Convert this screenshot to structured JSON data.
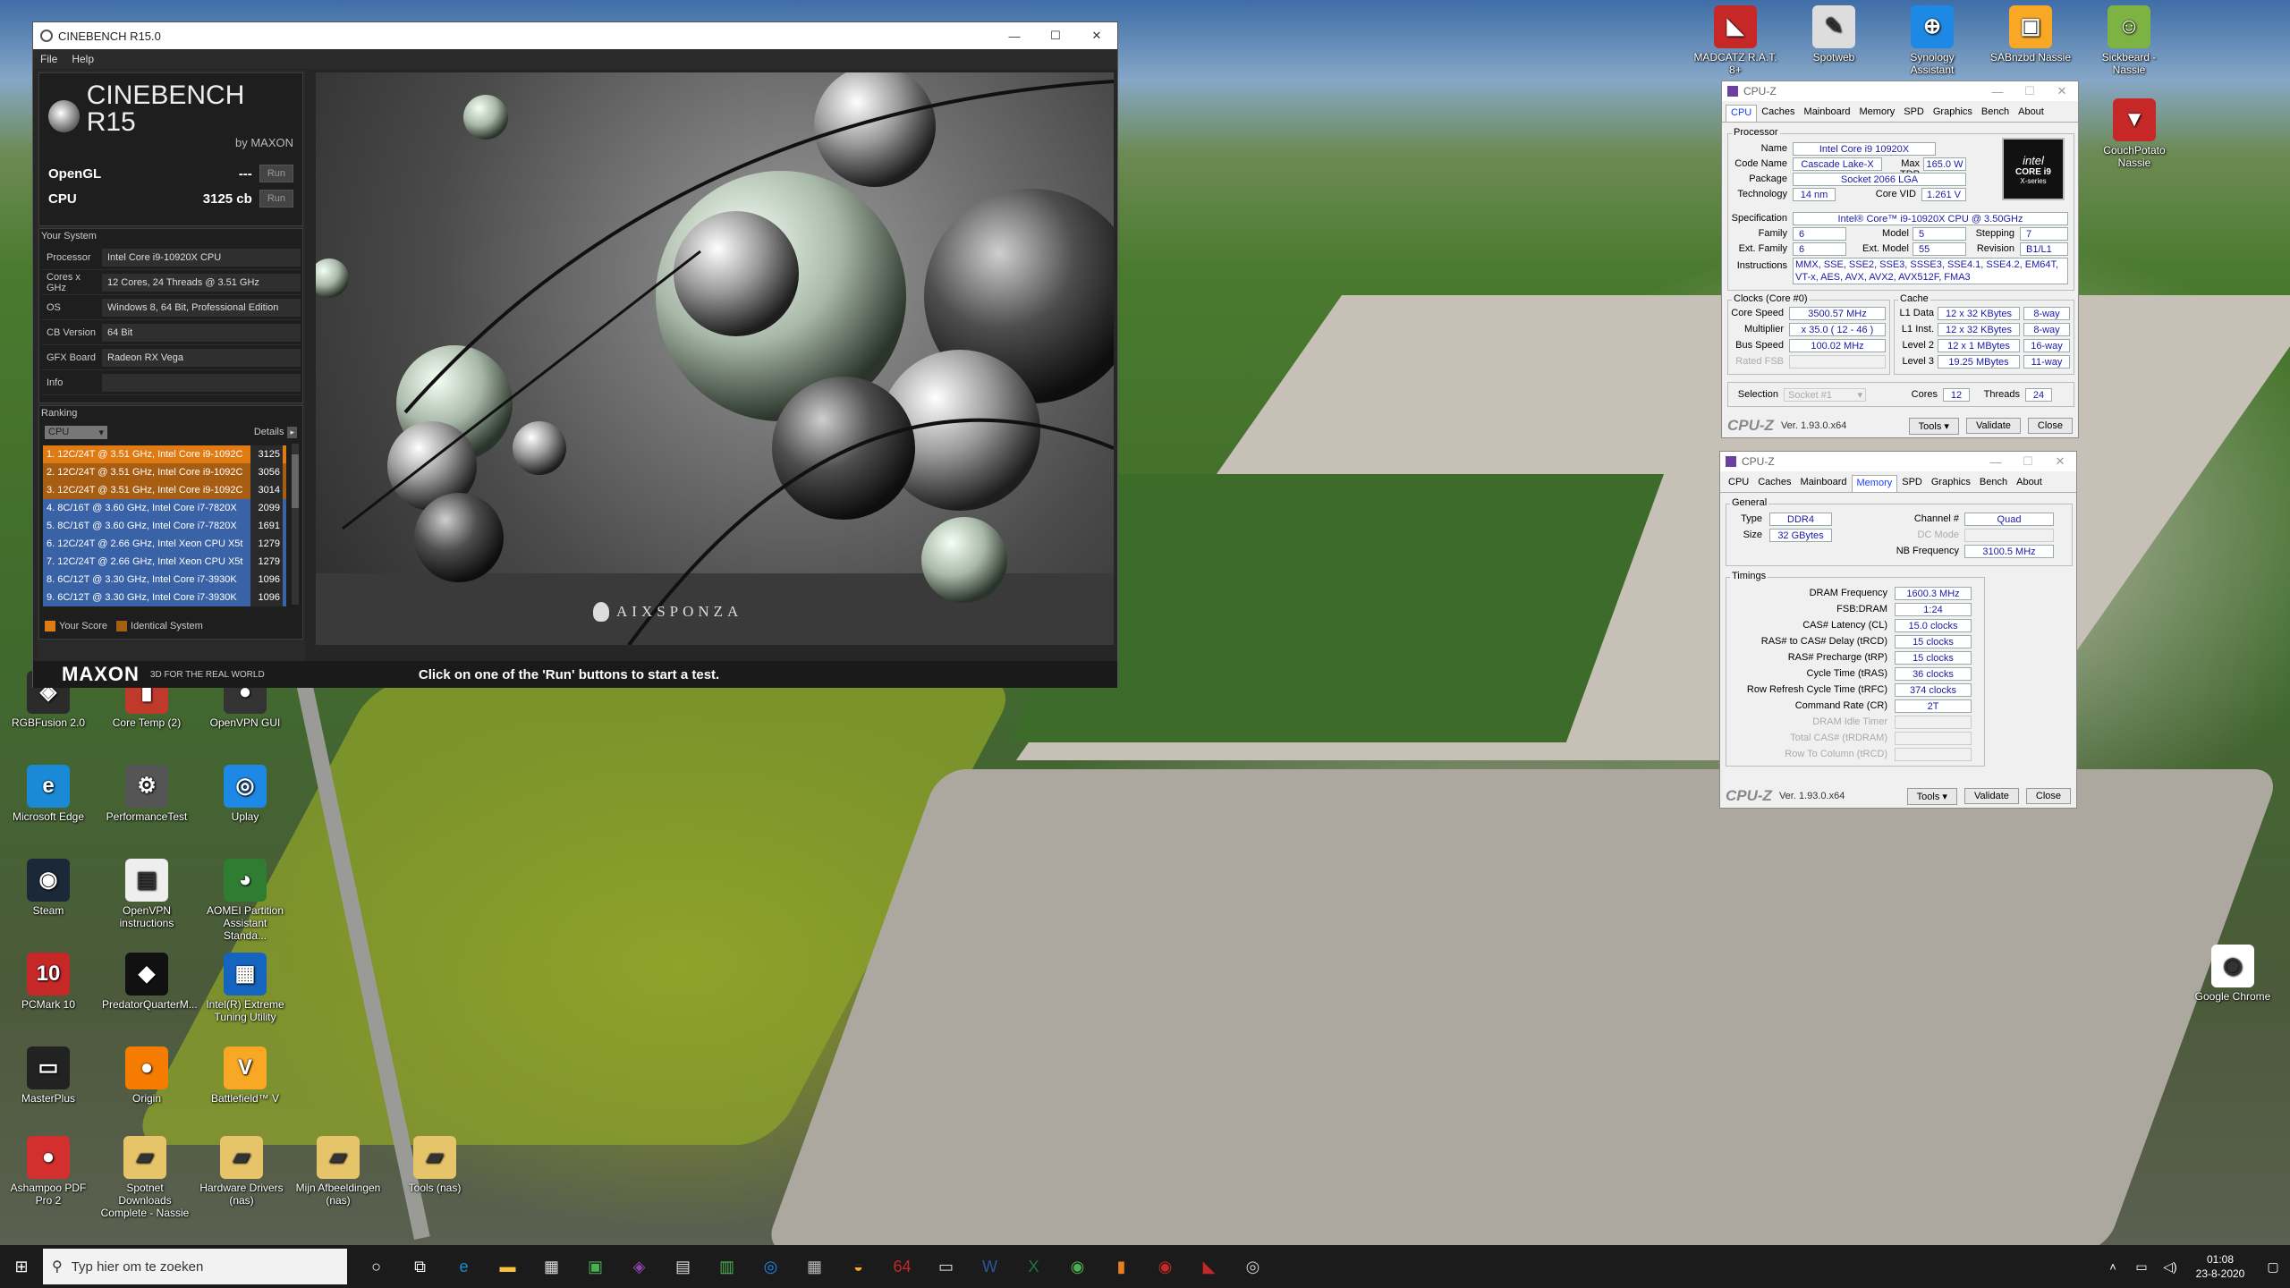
{
  "cinebench": {
    "title": "CINEBENCH R15.0",
    "menu": [
      "File",
      "Help"
    ],
    "logo_title": "CINEBENCH R15",
    "logo_by": "by MAXON",
    "opengl_label": "OpenGL",
    "opengl_value": "---",
    "cpu_label": "CPU",
    "cpu_value": "3125 cb",
    "run_label": "Run",
    "system_header": "Your System",
    "system": [
      {
        "k": "Processor",
        "v": "Intel Core i9-10920X CPU"
      },
      {
        "k": "Cores x GHz",
        "v": "12 Cores, 24 Threads @ 3.51 GHz"
      },
      {
        "k": "OS",
        "v": "Windows 8, 64 Bit, Professional Edition"
      },
      {
        "k": "CB Version",
        "v": "64 Bit"
      },
      {
        "k": "GFX Board",
        "v": "Radeon RX Vega"
      },
      {
        "k": "Info",
        "v": ""
      }
    ],
    "ranking_header": "Ranking",
    "ranking_select": "CPU",
    "details_label": "Details",
    "ranking": [
      {
        "name": "1. 12C/24T @ 3.51 GHz, Intel Core i9-1092C",
        "score": "3125",
        "kind": "mine"
      },
      {
        "name": "2. 12C/24T @ 3.51 GHz, Intel Core i9-1092C",
        "score": "3056",
        "kind": "identical"
      },
      {
        "name": "3. 12C/24T @ 3.51 GHz, Intel Core i9-1092C",
        "score": "3014",
        "kind": "identical"
      },
      {
        "name": "4. 8C/16T @ 3.60 GHz, Intel Core i7-7820X",
        "score": "2099",
        "kind": "other"
      },
      {
        "name": "5. 8C/16T @ 3.60 GHz, Intel Core i7-7820X",
        "score": "1691",
        "kind": "other"
      },
      {
        "name": "6. 12C/24T @ 2.66 GHz, Intel Xeon CPU X5t",
        "score": "1279",
        "kind": "other"
      },
      {
        "name": "7. 12C/24T @ 2.66 GHz, Intel Xeon CPU X5t",
        "score": "1279",
        "kind": "other"
      },
      {
        "name": "8. 6C/12T @ 3.30 GHz,  Intel Core i7-3930K",
        "score": "1096",
        "kind": "other"
      },
      {
        "name": "9. 6C/12T @ 3.30 GHz,  Intel Core i7-3930K",
        "score": "1096",
        "kind": "other"
      }
    ],
    "legend_your": "Your Score",
    "legend_identical": "Identical System",
    "footer_brand": "MAXON",
    "footer_tag": "3D FOR THE REAL WORLD",
    "status": "Click on one of the 'Run' buttons to start a test.",
    "render_brand": "AIXSPONZA"
  },
  "cpuz1": {
    "title": "CPU-Z",
    "tabs": [
      "CPU",
      "Caches",
      "Mainboard",
      "Memory",
      "SPD",
      "Graphics",
      "Bench",
      "About"
    ],
    "processor_label": "Processor",
    "name_l": "Name",
    "name_v": "Intel Core i9 10920X",
    "code_l": "Code Name",
    "code_v": "Cascade Lake-X",
    "tdp_l": "Max TDP",
    "tdp_v": "165.0 W",
    "pkg_l": "Package",
    "pkg_v": "Socket 2066 LGA",
    "tech_l": "Technology",
    "tech_v": "14 nm",
    "vid_l": "Core VID",
    "vid_v": "1.261 V",
    "spec_l": "Specification",
    "spec_v": "Intel® Core™ i9-10920X CPU @ 3.50GHz",
    "fam_l": "Family",
    "fam_v": "6",
    "model_l": "Model",
    "model_v": "5",
    "step_l": "Stepping",
    "step_v": "7",
    "extfam_l": "Ext. Family",
    "extfam_v": "6",
    "extmod_l": "Ext. Model",
    "extmod_v": "55",
    "rev_l": "Revision",
    "rev_v": "B1/L1",
    "instr_l": "Instructions",
    "instr_v": "MMX, SSE, SSE2, SSE3, SSSE3, SSE4.1, SSE4.2, EM64T, VT-x, AES, AVX, AVX2, AVX512F, FMA3",
    "badge_top": "intel",
    "badge_mid": "CORE i9",
    "badge_bot": "X-series",
    "clocks_label": "Clocks (Core #0)",
    "cs_l": "Core Speed",
    "cs_v": "3500.57 MHz",
    "mul_l": "Multiplier",
    "mul_v": "x 35.0 ( 12 - 46 )",
    "bus_l": "Bus Speed",
    "bus_v": "100.02 MHz",
    "fsb_l": "Rated FSB",
    "cache_label": "Cache",
    "l1d_l": "L1 Data",
    "l1d_v": "12 x 32 KBytes",
    "l1d_w": "8-way",
    "l1i_l": "L1 Inst.",
    "l1i_v": "12 x 32 KBytes",
    "l1i_w": "8-way",
    "l2_l": "Level 2",
    "l2_v": "12 x 1 MBytes",
    "l2_w": "16-way",
    "l3_l": "Level 3",
    "l3_v": "19.25 MBytes",
    "l3_w": "11-way",
    "sel_l": "Selection",
    "sel_v": "Socket #1",
    "cores_l": "Cores",
    "cores_v": "12",
    "threads_l": "Threads",
    "threads_v": "24",
    "brand": "CPU-Z",
    "version": "Ver. 1.93.0.x64",
    "tools": "Tools",
    "validate": "Validate",
    "close": "Close"
  },
  "cpuz2": {
    "title": "CPU-Z",
    "general_label": "General",
    "type_l": "Type",
    "type_v": "DDR4",
    "size_l": "Size",
    "size_v": "32 GBytes",
    "chan_l": "Channel #",
    "chan_v": "Quad",
    "dc_l": "DC Mode",
    "nb_l": "NB Frequency",
    "nb_v": "3100.5 MHz",
    "timings_label": "Timings",
    "timings": [
      {
        "l": "DRAM Frequency",
        "v": "1600.3 MHz",
        "dis": false
      },
      {
        "l": "FSB:DRAM",
        "v": "1:24",
        "dis": false
      },
      {
        "l": "CAS# Latency (CL)",
        "v": "15.0 clocks",
        "dis": false
      },
      {
        "l": "RAS# to CAS# Delay (tRCD)",
        "v": "15 clocks",
        "dis": false
      },
      {
        "l": "RAS# Precharge (tRP)",
        "v": "15 clocks",
        "dis": false
      },
      {
        "l": "Cycle Time (tRAS)",
        "v": "36 clocks",
        "dis": false
      },
      {
        "l": "Row Refresh Cycle Time (tRFC)",
        "v": "374 clocks",
        "dis": false
      },
      {
        "l": "Command Rate (CR)",
        "v": "2T",
        "dis": false
      },
      {
        "l": "DRAM Idle Timer",
        "v": "",
        "dis": true
      },
      {
        "l": "Total CAS# (tRDRAM)",
        "v": "",
        "dis": true
      },
      {
        "l": "Row To Column (tRCD)",
        "v": "",
        "dis": true
      }
    ]
  },
  "desktop_icons_left": [
    {
      "label": "RGBFusion 2.0",
      "color": "#2b2b2b",
      "glyph": "◈"
    },
    {
      "label": "Core Temp (2)",
      "color": "#c0392b",
      "glyph": "▮"
    },
    {
      "label": "OpenVPN GUI",
      "color": "#333",
      "glyph": "●"
    },
    {
      "label": "Microsoft Edge",
      "color": "#1b8ad6",
      "glyph": "e"
    },
    {
      "label": "PerformanceTest",
      "color": "#555",
      "glyph": "⚙"
    },
    {
      "label": "Uplay",
      "color": "#1e88e5",
      "glyph": "◎"
    },
    {
      "label": "Steam",
      "color": "#1b2838",
      "glyph": "◉"
    },
    {
      "label": "OpenVPN instructions",
      "color": "#eee",
      "glyph": "▤"
    },
    {
      "label": "AOMEI Partition Assistant Standa...",
      "color": "#2e7d32",
      "glyph": "◕"
    },
    {
      "label": "PCMark 10",
      "color": "#c62828",
      "glyph": "10"
    },
    {
      "label": "PredatorQuarterM...",
      "color": "#111",
      "glyph": "◆"
    },
    {
      "label": "Intel(R) Extreme Tuning Utility",
      "color": "#1565c0",
      "glyph": "▦"
    },
    {
      "label": "MasterPlus",
      "color": "#222",
      "glyph": "▭"
    },
    {
      "label": "Origin",
      "color": "#f57c00",
      "glyph": "●"
    },
    {
      "label": "Battlefield™ V",
      "color": "#f9a825",
      "glyph": "V"
    },
    {
      "label": "Ashampoo PDF Pro 2",
      "color": "#d32f2f",
      "glyph": "●"
    },
    {
      "label": "Spotnet Downloads Complete - Nassie",
      "color": "#e6c46a",
      "glyph": "▰"
    },
    {
      "label": "Hardware Drivers (nas)",
      "color": "#e6c46a",
      "glyph": "▰"
    },
    {
      "label": "Mijn Afbeeldingen (nas)",
      "color": "#e6c46a",
      "glyph": "▰"
    },
    {
      "label": "Tools (nas)",
      "color": "#e6c46a",
      "glyph": "▰"
    }
  ],
  "desktop_icons_top": [
    {
      "label": "MADCATZ R.A.T. 8+",
      "color": "#c62828",
      "glyph": "◣"
    },
    {
      "label": "Spotweb",
      "color": "#ddd",
      "glyph": "✎"
    },
    {
      "label": "Synology Assistant",
      "color": "#1e88e5",
      "glyph": "⊕"
    },
    {
      "label": "SABnzbd Nassie",
      "color": "#f9a825",
      "glyph": "▣"
    },
    {
      "label": "Sickbeard - Nassie",
      "color": "#7cb342",
      "glyph": "☺"
    }
  ],
  "desktop_icons_right": [
    {
      "label": "CouchPotato Nassie",
      "color": "#c62828",
      "glyph": "▼"
    },
    {
      "label": "Google Chrome",
      "color": "#fff",
      "glyph": "◉"
    }
  ],
  "taskbar": {
    "search_placeholder": "Typ hier om te zoeken",
    "time": "01:08",
    "date": "23-8-2020",
    "pinned": [
      {
        "name": "cortana",
        "glyph": "○",
        "color": "#fff"
      },
      {
        "name": "task-view",
        "glyph": "⧉",
        "color": "#fff"
      },
      {
        "name": "edge",
        "glyph": "e",
        "color": "#1b8ad6"
      },
      {
        "name": "explorer",
        "glyph": "▬",
        "color": "#f6c142"
      },
      {
        "name": "store",
        "glyph": "▦",
        "color": "#ddd"
      },
      {
        "name": "xbox",
        "glyph": "▣",
        "color": "#4caf50"
      },
      {
        "name": "cpuz",
        "glyph": "◈",
        "color": "#8e44ad"
      },
      {
        "name": "app6",
        "glyph": "▤",
        "color": "#ddd"
      },
      {
        "name": "app7",
        "glyph": "▥",
        "color": "#4caf50"
      },
      {
        "name": "uplay",
        "glyph": "◎",
        "color": "#1e88e5"
      },
      {
        "name": "app9",
        "glyph": "▦",
        "color": "#bbb"
      },
      {
        "name": "app10",
        "glyph": "◒",
        "color": "#f9a825"
      },
      {
        "name": "aida64",
        "glyph": "64",
        "color": "#c62828"
      },
      {
        "name": "outlook",
        "glyph": "▭",
        "color": "#ddd"
      },
      {
        "name": "word",
        "glyph": "W",
        "color": "#2b579a"
      },
      {
        "name": "excel",
        "glyph": "X",
        "color": "#217346"
      },
      {
        "name": "chrome",
        "glyph": "◉",
        "color": "#4caf50"
      },
      {
        "name": "hwinfo",
        "glyph": "▮",
        "color": "#e67e22"
      },
      {
        "name": "app18",
        "glyph": "◉",
        "color": "#c62828"
      },
      {
        "name": "madcatz",
        "glyph": "◣",
        "color": "#c62828"
      },
      {
        "name": "cinebench",
        "glyph": "◎",
        "color": "#ccc"
      }
    ]
  }
}
